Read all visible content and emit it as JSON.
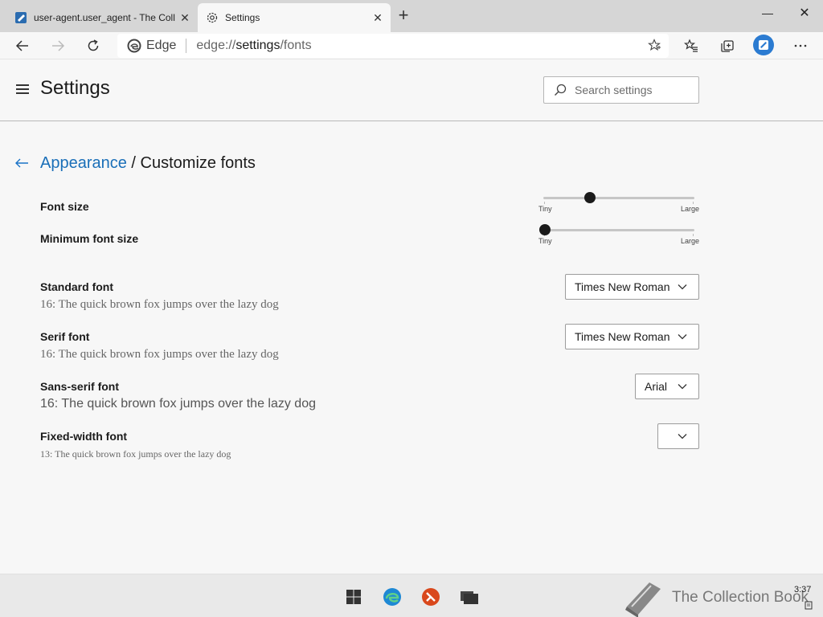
{
  "tabs": [
    {
      "title": "user-agent.user_agent - The Coll",
      "favicon": "book-icon",
      "close": "✕"
    },
    {
      "title": "Settings",
      "favicon": "gear-icon",
      "close": "✕"
    }
  ],
  "window_controls": {
    "minimize": "—",
    "maximize": "☐",
    "close": "✕"
  },
  "newtab": "+",
  "toolbar": {
    "site_label": "Edge",
    "url_host": "edge://",
    "url_rest_bold": "settings",
    "url_rest": "/fonts",
    "accent": "#2b7bd1"
  },
  "header": {
    "title": "Settings",
    "search_placeholder": "Search settings"
  },
  "breadcrumb": {
    "parent": "Appearance",
    "separator": " / ",
    "current": "Customize fonts"
  },
  "font_size": {
    "label": "Font size",
    "min_label": "Tiny",
    "max_label": "Large",
    "level": 0.3
  },
  "min_font_size": {
    "label": "Minimum font size",
    "min_label": "Tiny",
    "max_label": "Large",
    "level": 0.0
  },
  "standard_font": {
    "label": "Standard font",
    "sample": "16: The quick brown fox jumps over the lazy dog",
    "value": "Times New Roman"
  },
  "serif_font": {
    "label": "Serif font",
    "sample": "16: The quick brown fox jumps over the lazy dog",
    "value": "Times New Roman"
  },
  "sans_font": {
    "label": "Sans-serif font",
    "sample": "16: The quick brown fox jumps over the lazy dog",
    "value": "Arial"
  },
  "fixed_font": {
    "label": "Fixed-width font",
    "sample": "13: The quick brown fox jumps over the lazy dog",
    "value": ""
  },
  "taskbar": {
    "watermark": "The Collection Book",
    "clock": "3:37"
  }
}
